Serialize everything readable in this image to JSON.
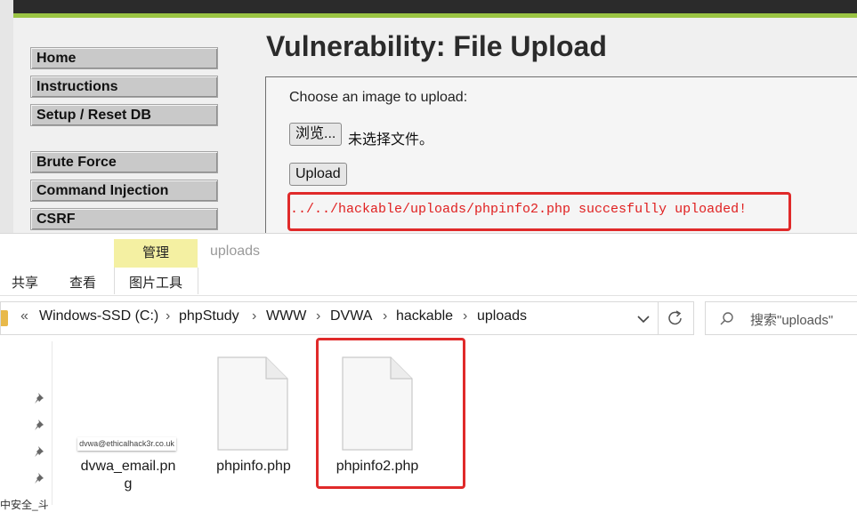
{
  "dvwa": {
    "menu": [
      "Home",
      "Instructions",
      "Setup / Reset DB",
      "Brute Force",
      "Command Injection",
      "CSRF"
    ],
    "title": "Vulnerability: File Upload",
    "form": {
      "prompt": "Choose an image to upload:",
      "browse_label": "浏览...",
      "no_file_label": "未选择文件。",
      "upload_label": "Upload",
      "result_message": "../../hackable/uploads/phpinfo2.php succesfully uploaded!"
    },
    "colors": {
      "accent_green": "#9ac443",
      "error_red": "#e02020"
    }
  },
  "explorer": {
    "ribbon": {
      "manage_tab": "管理",
      "folder_title": "uploads",
      "tabs": [
        "共享",
        "查看",
        "图片工具"
      ]
    },
    "address": {
      "breadcrumb": [
        "Windows-SSD (C:)",
        "phpStudy",
        "WWW",
        "DVWA",
        "hackable",
        "uploads"
      ]
    },
    "search": {
      "placeholder": "搜索\"uploads\""
    },
    "files": [
      {
        "name": "dvwa_email.png",
        "label_line1": "dvwa_email.pn",
        "label_line2": "g",
        "thumb_text": "dvwa@ethicalhack3r.co.uk",
        "icon": "image-thumbnail-icon"
      },
      {
        "name": "phpinfo.php",
        "icon": "blank-file-icon"
      },
      {
        "name": "phpinfo2.php",
        "icon": "blank-file-icon"
      }
    ],
    "nav_cut_text": "中安全_斗"
  }
}
